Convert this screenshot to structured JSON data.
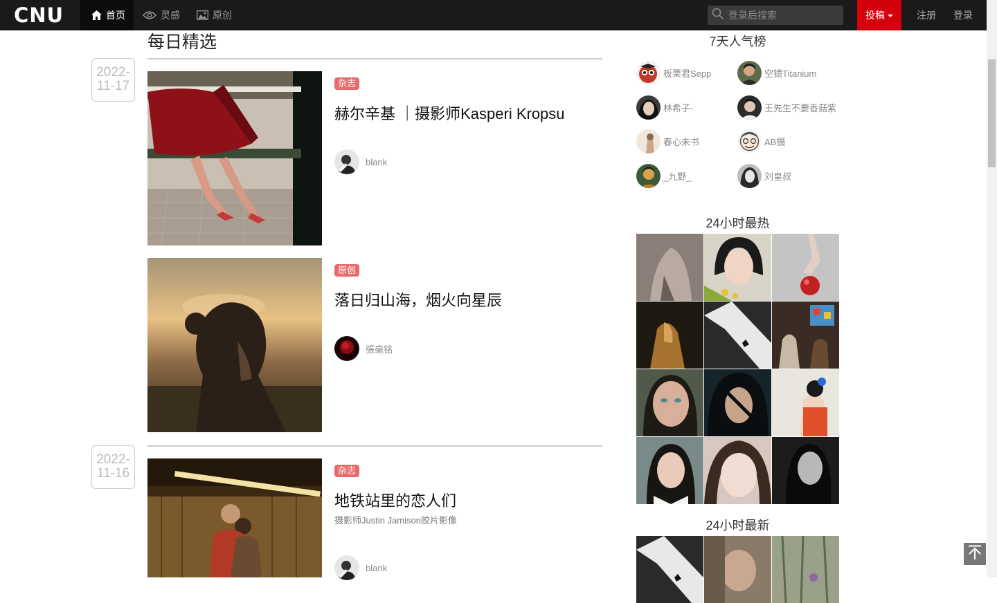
{
  "nav": {
    "logo": "CNU",
    "tabs": [
      {
        "label": "首页",
        "icon": "home-icon"
      },
      {
        "label": "灵感",
        "icon": "eye-icon"
      },
      {
        "label": "原创",
        "icon": "image-icon"
      }
    ],
    "search_placeholder": "登录后搜索",
    "submit_label": "投稿",
    "register_label": "注册",
    "login_label": "登录"
  },
  "main": {
    "section_title": "每日精选",
    "groups": [
      {
        "date_line1": "2022-",
        "date_line2": "11-17",
        "posts": [
          {
            "tag": "杂志",
            "title": "赫尔辛基 ｜摄影师Kasperi Kropsu",
            "subtitle": "",
            "author": "blank"
          },
          {
            "tag": "原创",
            "title": "落日归山海，烟火向星辰",
            "subtitle": "",
            "author": "張毫铭"
          }
        ]
      },
      {
        "date_line1": "2022-",
        "date_line2": "11-16",
        "posts": [
          {
            "tag": "杂志",
            "title": "地铁站里的恋人们",
            "subtitle": "摄影师Justin Jamison胶片影像",
            "author": "blank"
          }
        ]
      }
    ]
  },
  "sidebar": {
    "popular_title": "7天人气榜",
    "popular_users": [
      "板栗君Sepp",
      "空镜Titanium",
      "林希子-",
      "王先生不要香菇紫",
      "春心未书",
      "AB摄",
      "_九野_",
      "刘皇叔"
    ],
    "hot_title": "24小时最热",
    "new_title": "24小时最新"
  },
  "colors": {
    "nav_bg": "#1a1a1a",
    "accent_red": "#d4000e",
    "tag_red": "#e86a6a"
  }
}
